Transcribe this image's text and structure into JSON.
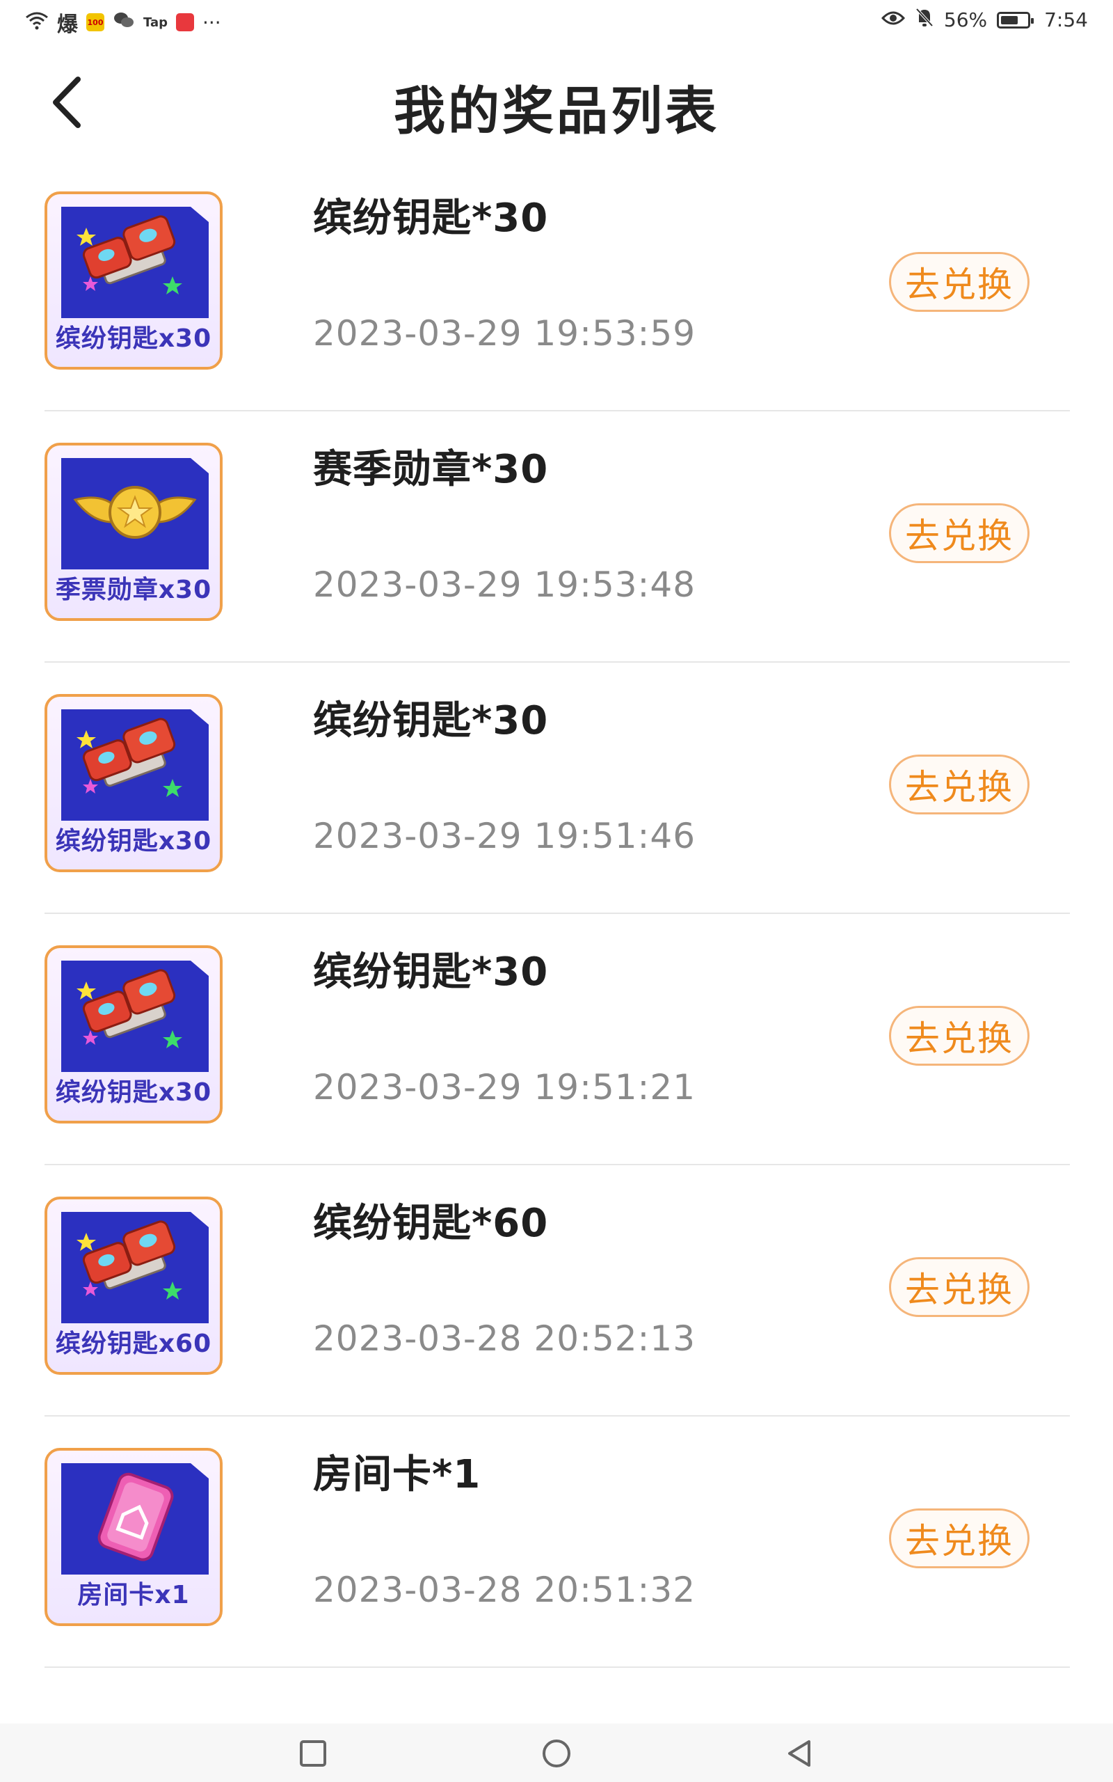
{
  "status_bar": {
    "left_icons": [
      "wifi-icon",
      "bao-app-icon",
      "100-app-icon",
      "wechat-icon",
      "tap-app-icon",
      "book-app-icon",
      "more-icon"
    ],
    "bao_text": "爆",
    "app_100_text": "100",
    "tap_text": "Tap",
    "more_text": "···",
    "battery_percent": "56%",
    "time": "7:54"
  },
  "header": {
    "title": "我的奖品列表"
  },
  "prizes": [
    {
      "title": "缤纷钥匙*30",
      "time": "2023-03-29 19:53:59",
      "thumb_label": "缤纷钥匙x30",
      "thumb_icon": "key-icon",
      "button": "去兑换"
    },
    {
      "title": "赛季勋章*30",
      "time": "2023-03-29 19:53:48",
      "thumb_label": "季票勋章x30",
      "thumb_icon": "medal-icon",
      "button": "去兑换"
    },
    {
      "title": "缤纷钥匙*30",
      "time": "2023-03-29 19:51:46",
      "thumb_label": "缤纷钥匙x30",
      "thumb_icon": "key-icon",
      "button": "去兑换"
    },
    {
      "title": "缤纷钥匙*30",
      "time": "2023-03-29 19:51:21",
      "thumb_label": "缤纷钥匙x30",
      "thumb_icon": "key-icon",
      "button": "去兑换"
    },
    {
      "title": "缤纷钥匙*60",
      "time": "2023-03-28 20:52:13",
      "thumb_label": "缤纷钥匙x60",
      "thumb_icon": "key-icon",
      "button": "去兑换"
    },
    {
      "title": "房间卡*1",
      "time": "2023-03-28 20:51:32",
      "thumb_label": "房间卡x1",
      "thumb_icon": "room-card-icon",
      "button": "去兑换"
    }
  ],
  "colors": {
    "accent": "#ef8a1d",
    "thumb_border": "#f0a04a",
    "thumb_bg": "#2a2eb8"
  }
}
